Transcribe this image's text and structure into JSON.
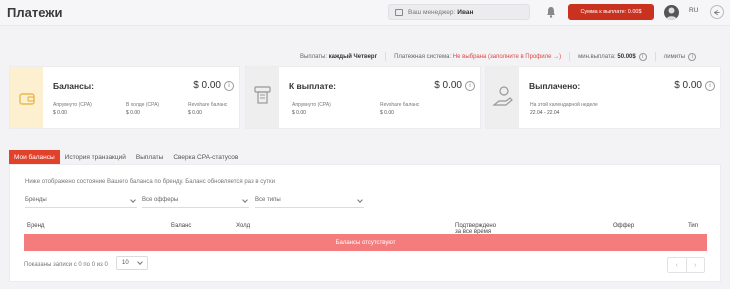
{
  "header": {
    "title": "Платежи",
    "manager_label": "Ваш менеджер:",
    "manager_name": "Иван",
    "balance_button": "Сумма к выплате: 0.00$",
    "lang": "RU"
  },
  "infoline": {
    "payouts_label": "Выплаты:",
    "payouts_value": "каждый Четверг",
    "system_label": "Платежная система:",
    "system_value": "Не выбрана (заполните в Профиле →)",
    "min_label": "мин.выплата:",
    "min_value": "50.00$",
    "limits": "лимиты"
  },
  "cards": [
    {
      "title": "Балансы:",
      "amount": "$ 0.00",
      "icon": "wallet-icon",
      "accent": "#fdf0d0",
      "fields": [
        {
          "label": "Апрувнуто (CPA)",
          "value": "$ 0.00"
        },
        {
          "label": "В холде (CPA)",
          "value": "$ 0.00"
        },
        {
          "label": "Revshare баланс",
          "value": "$ 0.00"
        }
      ]
    },
    {
      "title": "К выплате:",
      "amount": "$ 0.00",
      "icon": "atm-icon",
      "accent": "#eeeeee",
      "fields": [
        {
          "label": "Апрувнуто (CPA)",
          "value": "$ 0.00"
        },
        {
          "label": "Revshare баланс",
          "value": "$ 0.00"
        }
      ]
    },
    {
      "title": "Выплачено:",
      "amount": "$ 0.00",
      "icon": "money-hand-icon",
      "accent": "#eeeeee",
      "fields": [
        {
          "label": "На этой календарной неделе",
          "value": "22.04 - 22.04"
        }
      ]
    }
  ],
  "tabs": [
    "Мои балансы",
    "История транзакций",
    "Выплаты",
    "Сверка CPA-статусов"
  ],
  "panel": {
    "description": "Ниже отображено состояние Вашего баланса по бренду. Баланс обновляется раз в сутки",
    "filters": [
      "Бренды",
      "Все офферы",
      "Все типы"
    ],
    "columns": [
      "Бренд",
      "Баланс",
      "Холд",
      "Подтверждено за все время",
      "Оффер",
      "Тип"
    ],
    "empty_text": "Балансы отсутствуют",
    "shown_text": "Показаны записи с 0 по 0 из 0",
    "per_page": "10",
    "prev": "‹",
    "next": "›"
  },
  "colors": {
    "accent": "#e2412b",
    "button": "#c9321f",
    "empty_row": "#f47c7c"
  }
}
